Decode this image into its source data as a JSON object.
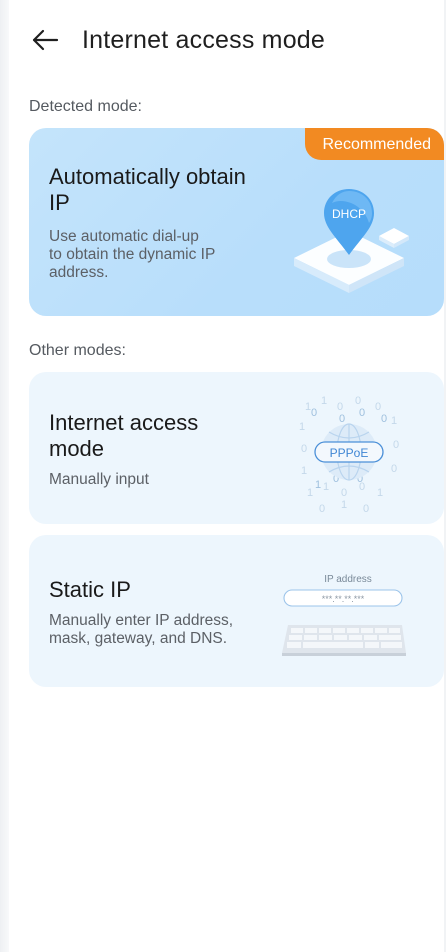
{
  "header": {
    "title": "Internet access mode",
    "back_icon": "arrow-left-icon"
  },
  "detected": {
    "label": "Detected mode:",
    "card": {
      "badge": "Recommended",
      "title_line1": "Automatically obtain",
      "title_line2": "IP",
      "desc_line1": "Use automatic dial-up",
      "desc_line2": "to obtain the dynamic IP",
      "desc_line3": "address.",
      "art_label": "DHCP"
    }
  },
  "other": {
    "label": "Other modes:",
    "pppoe": {
      "title_line1": "Internet access",
      "title_line2": "mode",
      "desc": "Manually input",
      "art_label": "PPPoE"
    },
    "static": {
      "title": "Static IP",
      "desc_line1": "Manually enter IP address,",
      "desc_line2": "mask, gateway, and DNS.",
      "art_label": "IP address",
      "art_mask": "***.**.**.***"
    }
  },
  "colors": {
    "accent": "#f28a22",
    "card_primary": "#bfe1fb",
    "card_secondary": "#edf6fd"
  }
}
